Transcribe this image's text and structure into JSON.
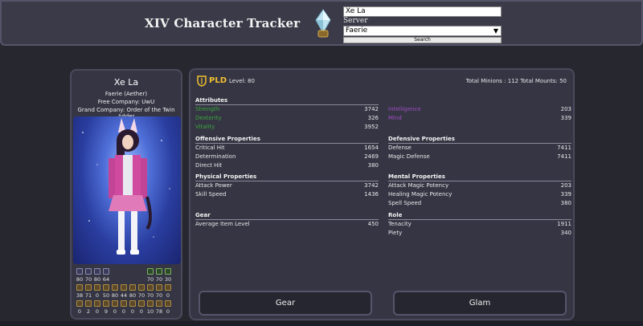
{
  "header": {
    "title": "XIV Character Tracker",
    "name_value": "Xe La",
    "server_label": "Server",
    "server_value": "Faerie",
    "search_label": "Search"
  },
  "character": {
    "name": "Xe La",
    "world": "Faerie (Aether)",
    "free_company": "Free Company: UwU",
    "grand_company": "Grand Company: Order of the Twin Adder"
  },
  "jobs": {
    "row1_levels": [
      "80",
      "70",
      "80",
      "64",
      "",
      "",
      "",
      "",
      "70",
      "70",
      "30"
    ],
    "row2_levels": [
      "38",
      "71",
      "0",
      "50",
      "80",
      "44",
      "80",
      "70",
      "70",
      "70",
      "0"
    ],
    "row3_levels": [
      "0",
      "2",
      "0",
      "9",
      "0",
      "0",
      "0",
      "0",
      "10",
      "78",
      "0"
    ]
  },
  "summary": {
    "job": "PLD",
    "level": "Level: 80",
    "totals": "Total Minions : 112 Total Mounts: 50"
  },
  "sections": {
    "attributes": "Attributes",
    "offensive": "Offensive Properties",
    "defensive": "Defensive Properties",
    "physical": "Physical Properties",
    "mental": "Mental Properties",
    "gear": "Gear",
    "role": "Role"
  },
  "stats": {
    "strength": {
      "label": "Strength",
      "value": "3742"
    },
    "dexterity": {
      "label": "Dexterity",
      "value": "326"
    },
    "vitality": {
      "label": "Vitality",
      "value": "3952"
    },
    "intelligence": {
      "label": "Intelligence",
      "value": "203"
    },
    "mind": {
      "label": "Mind",
      "value": "339"
    },
    "critical_hit": {
      "label": "Critical Hit",
      "value": "1654"
    },
    "determination": {
      "label": "Determination",
      "value": "2469"
    },
    "direct_hit": {
      "label": "Direct Hit",
      "value": "380"
    },
    "defense": {
      "label": "Defense",
      "value": "7411"
    },
    "magic_defense": {
      "label": "Magic Defense",
      "value": "7411"
    },
    "attack_power": {
      "label": "Attack Power",
      "value": "3742"
    },
    "skill_speed": {
      "label": "Skill Speed",
      "value": "1436"
    },
    "attack_magic_potency": {
      "label": "Attack Magic Potency",
      "value": "203"
    },
    "healing_magic_potency": {
      "label": "Healing Magic Potency",
      "value": "339"
    },
    "spell_speed": {
      "label": "Spell Speed",
      "value": "380"
    },
    "avg_item_level": {
      "label": "Average Item Level",
      "value": "450"
    },
    "tenacity": {
      "label": "Tenacity",
      "value": "1911"
    },
    "piety": {
      "label": "Piety",
      "value": "340"
    }
  },
  "buttons": {
    "gear": "Gear",
    "glam": "Glam"
  },
  "colors": {
    "accent_gold": "#f0c030",
    "physical_green": "#3aa83a",
    "magic_purple": "#a04ec0"
  }
}
